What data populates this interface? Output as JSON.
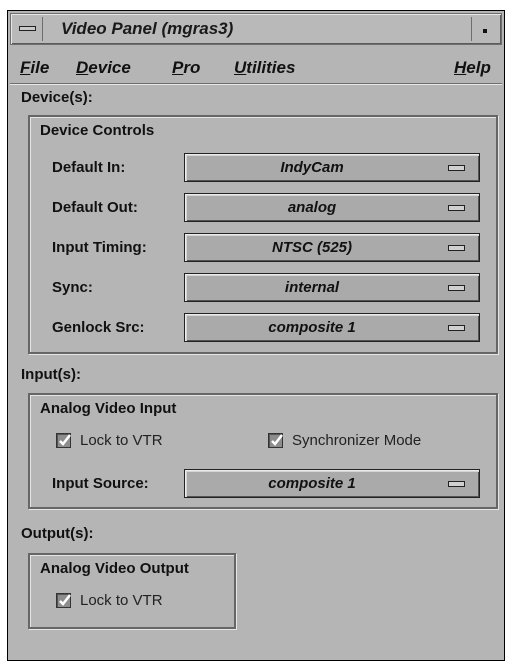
{
  "window": {
    "title": "Video Panel (mgras3)"
  },
  "menubar": [
    {
      "label": "File",
      "mnemonic": "F",
      "rest": "ile"
    },
    {
      "label": "Device",
      "mnemonic": "D",
      "rest": "evice"
    },
    {
      "label": "Pro",
      "mnemonic": "P",
      "rest": "ro"
    },
    {
      "label": "Utilities",
      "mnemonic": "U",
      "rest": "tilities"
    },
    {
      "label": "Help",
      "mnemonic": "H",
      "rest": "elp"
    }
  ],
  "devices": {
    "section_label": "Device(s):",
    "group_title": "Device Controls",
    "rows": [
      {
        "label": "Default In:",
        "value": "IndyCam"
      },
      {
        "label": "Default Out:",
        "value": "analog"
      },
      {
        "label": "Input Timing:",
        "value": "NTSC (525)"
      },
      {
        "label": "Sync:",
        "value": "internal"
      },
      {
        "label": "Genlock Src:",
        "value": "composite 1"
      }
    ]
  },
  "inputs": {
    "section_label": "Input(s):",
    "group_title": "Analog Video Input",
    "lock_to_vtr": {
      "label": "Lock to VTR",
      "checked": true
    },
    "synchronizer_mode": {
      "label": "Synchronizer Mode",
      "checked": true
    },
    "input_source": {
      "label": "Input Source:",
      "value": "composite 1"
    }
  },
  "outputs": {
    "section_label": "Output(s):",
    "group_title": "Analog Video Output",
    "lock_to_vtr": {
      "label": "Lock to VTR",
      "checked": true
    }
  }
}
